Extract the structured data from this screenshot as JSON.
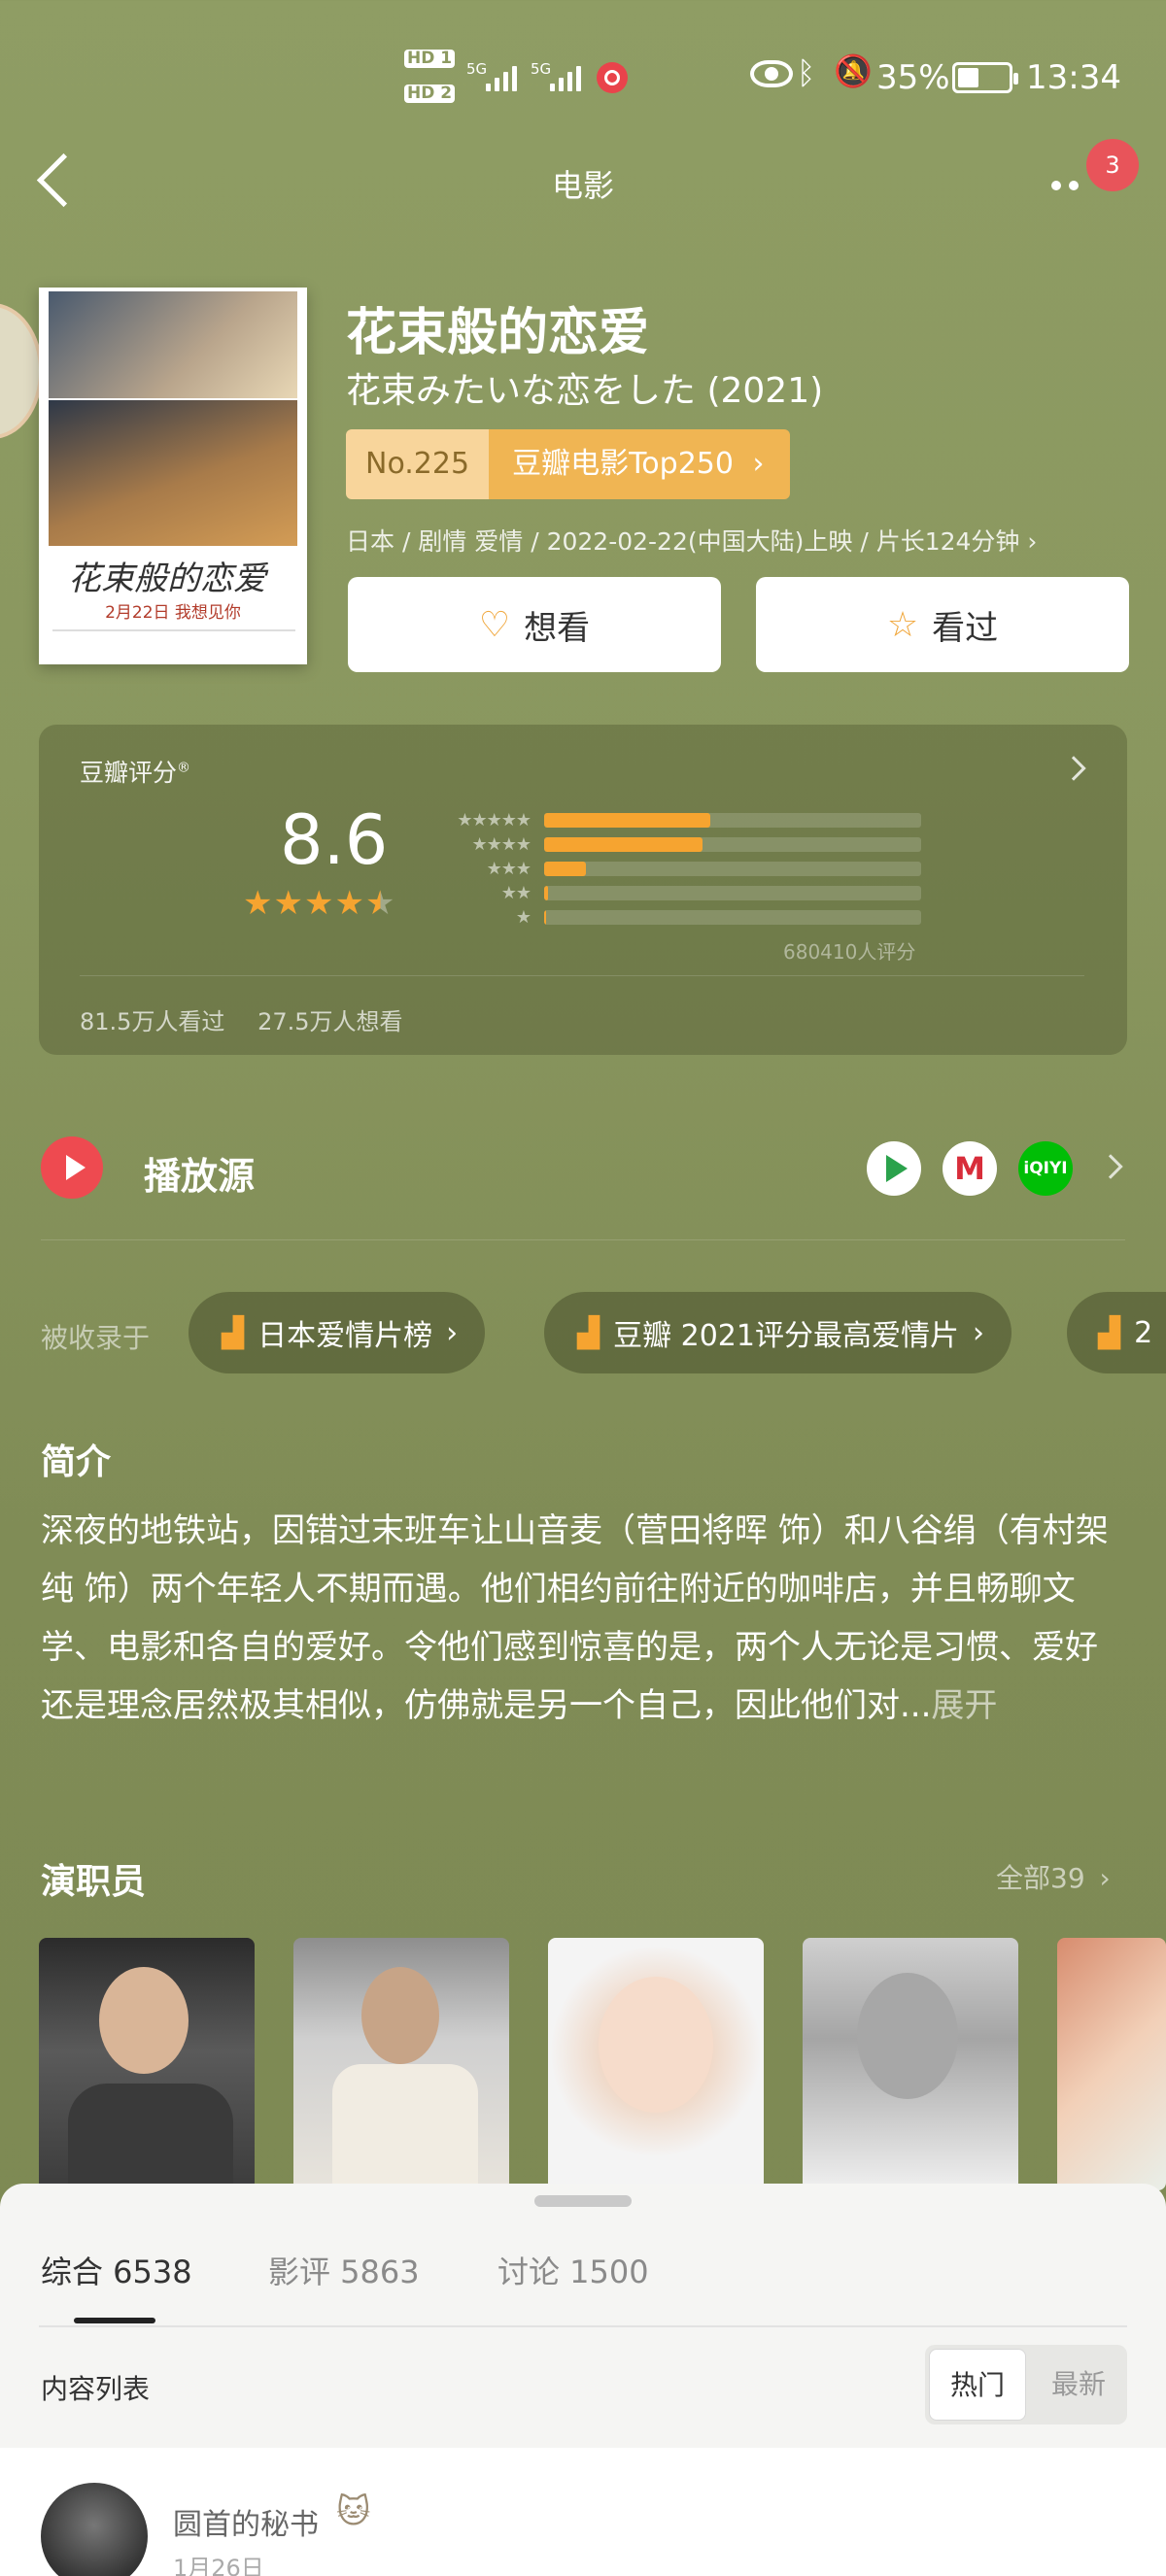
{
  "status_bar": {
    "hd1": "HD 1",
    "hd2": "HD 2",
    "net1": "5G",
    "net2": "5G",
    "battery": "35%",
    "time": "13:34"
  },
  "header": {
    "title": "电影",
    "badge": "3"
  },
  "movie": {
    "title": "花束般的恋爱",
    "original_title": "花束みたいな恋をした (2021)",
    "rank_no": "No.225",
    "rank_list": "豆瓣电影Top250",
    "meta": "日本 / 剧情 爱情 / 2022-02-22(中国大陆)上映 / 片长124分钟",
    "poster_title": "花束般的恋爱",
    "poster_tagline": "2月22日 我想见你",
    "want_label": "想看",
    "watched_label": "看过"
  },
  "rating": {
    "label": "豆瓣评分",
    "score": "8.6",
    "stars": 4.5,
    "distribution": [
      {
        "stars": "★★★★★",
        "fraction": 0.44
      },
      {
        "stars": "★★★★",
        "fraction": 0.42
      },
      {
        "stars": "★★★",
        "fraction": 0.11
      },
      {
        "stars": "★★",
        "fraction": 0.01
      },
      {
        "stars": "★",
        "fraction": 0.005
      }
    ],
    "count": "680410人评分",
    "watched": "81.5万人看过",
    "want": "27.5万人想看"
  },
  "play_source": {
    "title": "播放源",
    "sources": [
      "tencent-video-icon",
      "mango-tv-icon",
      "iqiyi-icon"
    ],
    "s2_text": "M",
    "s3_text": "iQIYI"
  },
  "collections": {
    "label": "被收录于",
    "items": [
      "日本爱情片榜",
      "豆瓣 2021评分最高爱情片",
      "2"
    ]
  },
  "synopsis": {
    "title": "简介",
    "text": "深夜的地铁站，因错过末班车让山音麦（菅田将晖 饰）和八谷绢（有村架纯 饰）两个年轻人不期而遇。他们相约前往附近的咖啡店，并且畅聊文学、电影和各自的爱好。令他们感到惊喜的是，两个人无论是习惯、爱好还是理念居然极其相似，仿佛就是另一个自己，因此他们对...",
    "expand": "展开"
  },
  "cast": {
    "title": "演职员",
    "all": "全部39"
  },
  "sheet": {
    "tabs": [
      "综合 6538",
      "影评 5863",
      "讨论 1500"
    ],
    "list_label": "内容列表",
    "sort_hot": "热门",
    "sort_new": "最新",
    "post": {
      "username": "圆首的秘书",
      "date": "1月26日"
    }
  },
  "colors": {
    "background": "#8a975f",
    "accent_orange": "#f6a430",
    "badge_red": "#e8545a"
  }
}
